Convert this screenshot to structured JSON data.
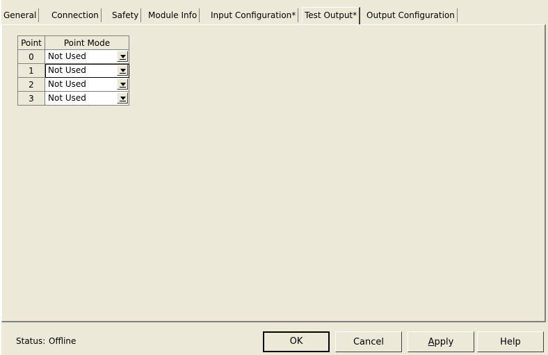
{
  "tabs": [
    {
      "label": "General"
    },
    {
      "label": "Connection"
    },
    {
      "label": "Safety"
    },
    {
      "label": "Module Info"
    },
    {
      "label": "Input Configuration*"
    },
    {
      "label": "Test Output*"
    },
    {
      "label": "Output Configuration"
    }
  ],
  "selected_tab": "Test Output*",
  "grid": {
    "headers": {
      "point": "Point",
      "mode": "Point Mode"
    },
    "rows": [
      {
        "point": "0",
        "mode": "Not Used"
      },
      {
        "point": "1",
        "mode": "Not Used"
      },
      {
        "point": "2",
        "mode": "Not Used"
      },
      {
        "point": "3",
        "mode": "Not Used"
      }
    ]
  },
  "status": {
    "label": "Status:",
    "value": "Offline"
  },
  "buttons": {
    "ok": "OK",
    "cancel": "Cancel",
    "apply_prefix": "A",
    "apply_rest": "pply",
    "help": "Help"
  }
}
